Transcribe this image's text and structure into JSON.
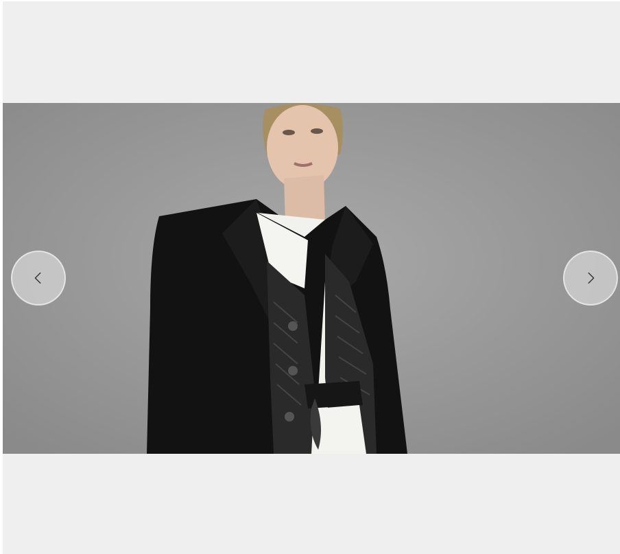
{
  "carousel": {
    "slide": {
      "image_description_icon": "fashion-model-photo",
      "background_color": "#9b9b9b"
    },
    "prev_button": {
      "icon": "chevron-left-icon"
    },
    "next_button": {
      "icon": "chevron-right-icon"
    }
  },
  "colors": {
    "page_background": "#efefef",
    "button_fill": "#d2d2d2",
    "chevron": "#333333"
  }
}
